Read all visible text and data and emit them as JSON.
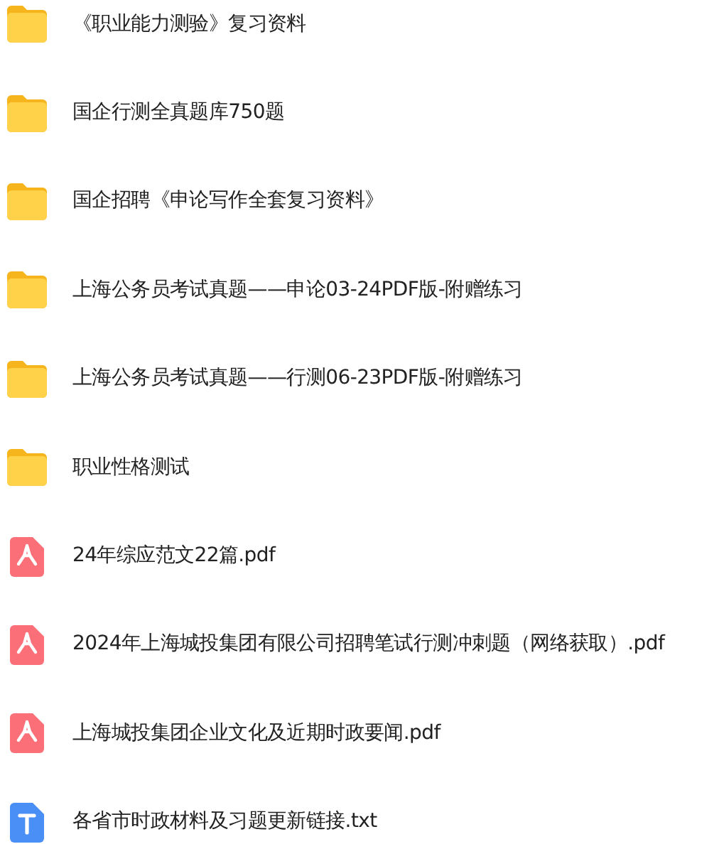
{
  "files": [
    {
      "kind": "folder",
      "name": "《职业能力测验》复习资料"
    },
    {
      "kind": "folder",
      "name": "国企行测全真题库750题"
    },
    {
      "kind": "folder",
      "name": "国企招聘《申论写作全套复习资料》"
    },
    {
      "kind": "folder",
      "name": "上海公务员考试真题——申论03-24PDF版-附赠练习"
    },
    {
      "kind": "folder",
      "name": "上海公务员考试真题——行测06-23PDF版-附赠练习"
    },
    {
      "kind": "folder",
      "name": "职业性格测试"
    },
    {
      "kind": "pdf",
      "name": "24年综应范文22篇.pdf"
    },
    {
      "kind": "pdf",
      "name": "2024年上海城投集团有限公司招聘笔试行测冲刺题（网络获取）.pdf"
    },
    {
      "kind": "pdf",
      "name": "上海城投集团企业文化及近期时政要闻.pdf"
    },
    {
      "kind": "txt",
      "name": "各省市时政材料及习题更新链接.txt"
    }
  ]
}
